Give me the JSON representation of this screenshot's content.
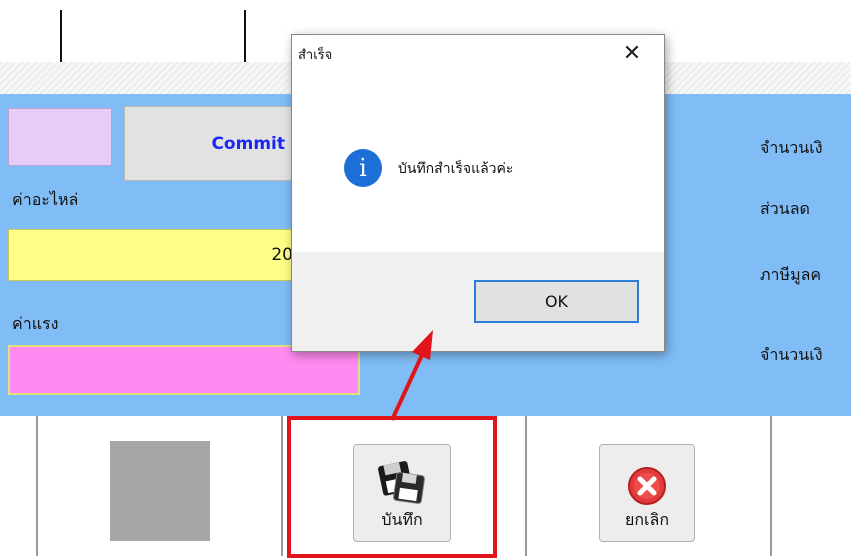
{
  "form": {
    "commit_label": "Commit",
    "parts_label": "ค่าอะไหล่",
    "parts_value": "20",
    "labor_label": "ค่าแรง",
    "right_labels": [
      "จำนวนเงิ",
      "ส่วนลด",
      "ภาษีมูลค",
      "จำนวนเงิ"
    ]
  },
  "toolbar": {
    "save_label": "บันทึก",
    "cancel_label": "ยกเลิก"
  },
  "dialog": {
    "title": "สำเร็จ",
    "close_glyph": "✕",
    "info_glyph": "i",
    "message": "บันทึกสำเร็จแล้วค่ะ",
    "ok_label": "OK"
  },
  "colors": {
    "panel": "#80bdf6",
    "highlight": "#e0141a",
    "commit_text": "#1b28f5",
    "yellow_field": "#ffff88",
    "pink_field": "#ff8bf2"
  },
  "icons": [
    "floppy-disk-icon",
    "cancel-x-icon",
    "info-icon",
    "close-icon"
  ]
}
